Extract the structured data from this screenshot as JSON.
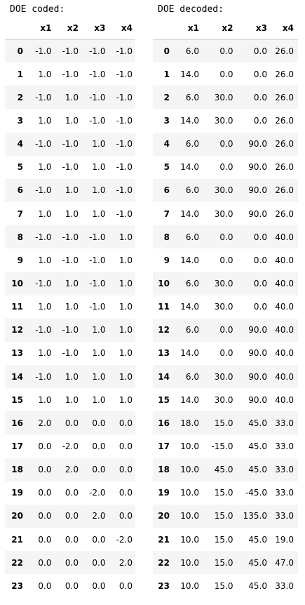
{
  "coded": {
    "caption": "DOE coded:",
    "columns": [
      "x1",
      "x2",
      "x3",
      "x4"
    ],
    "rows": [
      {
        "index": "0",
        "values": [
          "-1.0",
          "-1.0",
          "-1.0",
          "-1.0"
        ]
      },
      {
        "index": "1",
        "values": [
          "1.0",
          "-1.0",
          "-1.0",
          "-1.0"
        ]
      },
      {
        "index": "2",
        "values": [
          "-1.0",
          "1.0",
          "-1.0",
          "-1.0"
        ]
      },
      {
        "index": "3",
        "values": [
          "1.0",
          "1.0",
          "-1.0",
          "-1.0"
        ]
      },
      {
        "index": "4",
        "values": [
          "-1.0",
          "-1.0",
          "1.0",
          "-1.0"
        ]
      },
      {
        "index": "5",
        "values": [
          "1.0",
          "-1.0",
          "1.0",
          "-1.0"
        ]
      },
      {
        "index": "6",
        "values": [
          "-1.0",
          "1.0",
          "1.0",
          "-1.0"
        ]
      },
      {
        "index": "7",
        "values": [
          "1.0",
          "1.0",
          "1.0",
          "-1.0"
        ]
      },
      {
        "index": "8",
        "values": [
          "-1.0",
          "-1.0",
          "-1.0",
          "1.0"
        ]
      },
      {
        "index": "9",
        "values": [
          "1.0",
          "-1.0",
          "-1.0",
          "1.0"
        ]
      },
      {
        "index": "10",
        "values": [
          "-1.0",
          "1.0",
          "-1.0",
          "1.0"
        ]
      },
      {
        "index": "11",
        "values": [
          "1.0",
          "1.0",
          "-1.0",
          "1.0"
        ]
      },
      {
        "index": "12",
        "values": [
          "-1.0",
          "-1.0",
          "1.0",
          "1.0"
        ]
      },
      {
        "index": "13",
        "values": [
          "1.0",
          "-1.0",
          "1.0",
          "1.0"
        ]
      },
      {
        "index": "14",
        "values": [
          "-1.0",
          "1.0",
          "1.0",
          "1.0"
        ]
      },
      {
        "index": "15",
        "values": [
          "1.0",
          "1.0",
          "1.0",
          "1.0"
        ]
      },
      {
        "index": "16",
        "values": [
          "2.0",
          "0.0",
          "0.0",
          "0.0"
        ]
      },
      {
        "index": "17",
        "values": [
          "0.0",
          "-2.0",
          "0.0",
          "0.0"
        ]
      },
      {
        "index": "18",
        "values": [
          "0.0",
          "2.0",
          "0.0",
          "0.0"
        ]
      },
      {
        "index": "19",
        "values": [
          "0.0",
          "0.0",
          "-2.0",
          "0.0"
        ]
      },
      {
        "index": "20",
        "values": [
          "0.0",
          "0.0",
          "2.0",
          "0.0"
        ]
      },
      {
        "index": "21",
        "values": [
          "0.0",
          "0.0",
          "0.0",
          "-2.0"
        ]
      },
      {
        "index": "22",
        "values": [
          "0.0",
          "0.0",
          "0.0",
          "2.0"
        ]
      },
      {
        "index": "23",
        "values": [
          "0.0",
          "0.0",
          "0.0",
          "0.0"
        ]
      }
    ]
  },
  "decoded": {
    "caption": "DOE decoded:",
    "columns": [
      "x1",
      "x2",
      "x3",
      "x4"
    ],
    "rows": [
      {
        "index": "0",
        "values": [
          "6.0",
          "0.0",
          "0.0",
          "26.0"
        ]
      },
      {
        "index": "1",
        "values": [
          "14.0",
          "0.0",
          "0.0",
          "26.0"
        ]
      },
      {
        "index": "2",
        "values": [
          "6.0",
          "30.0",
          "0.0",
          "26.0"
        ]
      },
      {
        "index": "3",
        "values": [
          "14.0",
          "30.0",
          "0.0",
          "26.0"
        ]
      },
      {
        "index": "4",
        "values": [
          "6.0",
          "0.0",
          "90.0",
          "26.0"
        ]
      },
      {
        "index": "5",
        "values": [
          "14.0",
          "0.0",
          "90.0",
          "26.0"
        ]
      },
      {
        "index": "6",
        "values": [
          "6.0",
          "30.0",
          "90.0",
          "26.0"
        ]
      },
      {
        "index": "7",
        "values": [
          "14.0",
          "30.0",
          "90.0",
          "26.0"
        ]
      },
      {
        "index": "8",
        "values": [
          "6.0",
          "0.0",
          "0.0",
          "40.0"
        ]
      },
      {
        "index": "9",
        "values": [
          "14.0",
          "0.0",
          "0.0",
          "40.0"
        ]
      },
      {
        "index": "10",
        "values": [
          "6.0",
          "30.0",
          "0.0",
          "40.0"
        ]
      },
      {
        "index": "11",
        "values": [
          "14.0",
          "30.0",
          "0.0",
          "40.0"
        ]
      },
      {
        "index": "12",
        "values": [
          "6.0",
          "0.0",
          "90.0",
          "40.0"
        ]
      },
      {
        "index": "13",
        "values": [
          "14.0",
          "0.0",
          "90.0",
          "40.0"
        ]
      },
      {
        "index": "14",
        "values": [
          "6.0",
          "30.0",
          "90.0",
          "40.0"
        ]
      },
      {
        "index": "15",
        "values": [
          "14.0",
          "30.0",
          "90.0",
          "40.0"
        ]
      },
      {
        "index": "16",
        "values": [
          "18.0",
          "15.0",
          "45.0",
          "33.0"
        ]
      },
      {
        "index": "17",
        "values": [
          "10.0",
          "-15.0",
          "45.0",
          "33.0"
        ]
      },
      {
        "index": "18",
        "values": [
          "10.0",
          "45.0",
          "45.0",
          "33.0"
        ]
      },
      {
        "index": "19",
        "values": [
          "10.0",
          "15.0",
          "-45.0",
          "33.0"
        ]
      },
      {
        "index": "20",
        "values": [
          "10.0",
          "15.0",
          "135.0",
          "33.0"
        ]
      },
      {
        "index": "21",
        "values": [
          "10.0",
          "15.0",
          "45.0",
          "19.0"
        ]
      },
      {
        "index": "22",
        "values": [
          "10.0",
          "15.0",
          "45.0",
          "47.0"
        ]
      },
      {
        "index": "23",
        "values": [
          "10.0",
          "15.0",
          "45.0",
          "33.0"
        ]
      }
    ]
  }
}
